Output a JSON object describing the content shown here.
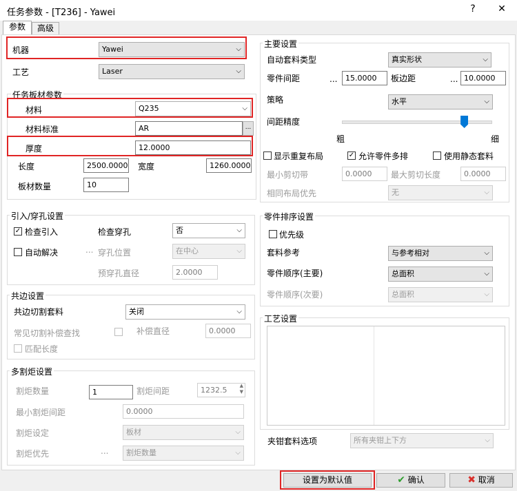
{
  "window": {
    "title": "任务参数 - [T236] - Yawei",
    "help": "?",
    "close": "✕"
  },
  "tabs": [
    {
      "label": "参数"
    },
    {
      "label": "高级"
    }
  ],
  "left": {
    "machine": {
      "label": "机器",
      "value": "Yawei"
    },
    "process": {
      "label": "工艺",
      "value": "Laser"
    },
    "sheet_group": {
      "title": "任务板材参数",
      "material": {
        "label": "材料",
        "value": "Q235"
      },
      "material_std": {
        "label": "材料标准",
        "value": "AR",
        "browse": "..."
      },
      "thickness": {
        "label": "厚度",
        "value": "12.0000"
      },
      "length": {
        "label": "长度",
        "value": "2500.0000"
      },
      "width": {
        "label": "宽度",
        "value": "1260.0000"
      },
      "count": {
        "label": "板材数量",
        "value": "10"
      }
    },
    "leadin_group": {
      "title": "引入/穿孔设置",
      "check_leadin": "检查引入",
      "check_pierce": {
        "label": "检查穿孔",
        "value": "否"
      },
      "auto_resolve": "自动解决",
      "dots": "...",
      "pierce_pos": {
        "label": "穿孔位置",
        "value": "在中心"
      },
      "prepierce_dia": {
        "label": "预穿孔直径",
        "value": "2.0000"
      }
    },
    "common_group": {
      "title": "共边设置",
      "common_cut": {
        "label": "共边切割套料",
        "value": "关闭"
      },
      "comp_search": "常见切割补偿查找",
      "comp_dia": {
        "label": "补偿直径",
        "value": "0.0000"
      },
      "match_len": "匹配长度"
    },
    "torch_group": {
      "title": "多割炬设置",
      "torch_count": {
        "label": "割炬数量",
        "value": "1"
      },
      "torch_spacing": {
        "label": "割炬间距",
        "value": "1232.5"
      },
      "min_spacing": {
        "label": "最小割炬间距",
        "value": "0.0000"
      },
      "torch_setting": {
        "label": "割炬设定",
        "value": "板材"
      },
      "torch_priority": {
        "label": "割炬优先",
        "dots": "...",
        "value": "割炬数量"
      }
    }
  },
  "right": {
    "main_group": {
      "title": "主要设置",
      "auto_nest_type": {
        "label": "自动套料类型",
        "value": "真实形状"
      },
      "part_spacing": {
        "label": "零件间距",
        "dots": "...",
        "value": "15.0000"
      },
      "edge_spacing": {
        "label": "板边距",
        "dots": "...",
        "value": "10.0000"
      },
      "strategy": {
        "label": "策略",
        "value": "水平"
      },
      "precision": {
        "label": "间距精度",
        "coarse": "粗",
        "fine": "细",
        "level": 0.82
      },
      "show_repeat": "显示重复布局",
      "allow_multi": "允许零件多排",
      "use_static": "使用静态套料",
      "min_cut": {
        "label": "最小剪切带",
        "value": "0.0000"
      },
      "max_cut": {
        "label": "最大剪切长度",
        "value": "0.0000"
      },
      "same_layout": {
        "label": "相同布局优先",
        "value": "无"
      }
    },
    "sort_group": {
      "title": "零件排序设置",
      "priority": "优先级",
      "nest_ref": {
        "label": "套料参考",
        "value": "与参考相对"
      },
      "order_main": {
        "label": "零件顺序(主要)",
        "value": "总面积"
      },
      "order_sec": {
        "label": "零件顺序(次要)",
        "value": "总面积"
      }
    },
    "process_group": {
      "title": "工艺设置"
    },
    "clamp": {
      "label": "夹钳套料选项",
      "value": "所有夹钳上下方"
    }
  },
  "footer": {
    "default_btn": "设置为默认值",
    "ok_btn": "确认",
    "cancel_btn": "取消"
  },
  "colors": {
    "highlight": "#e02424",
    "accent": "#0078d7"
  }
}
